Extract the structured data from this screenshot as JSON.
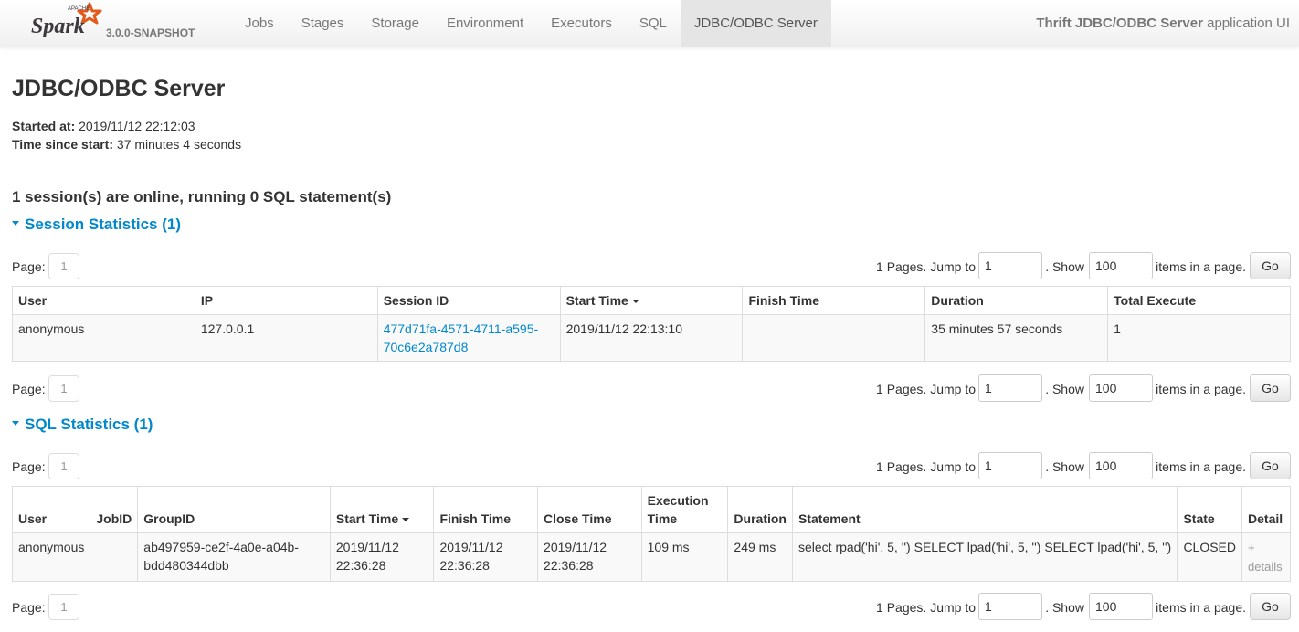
{
  "navbar": {
    "brand_super": "APACHE",
    "brand_name": "Spark",
    "version": "3.0.0-SNAPSHOT",
    "tabs": [
      {
        "label": "Jobs"
      },
      {
        "label": "Stages"
      },
      {
        "label": "Storage"
      },
      {
        "label": "Environment"
      },
      {
        "label": "Executors"
      },
      {
        "label": "SQL"
      },
      {
        "label": "JDBC/ODBC Server",
        "active": true
      }
    ],
    "app_title_bold": "Thrift JDBC/ODBC Server",
    "app_title_rest": " application UI"
  },
  "page": {
    "title": "JDBC/ODBC Server",
    "started_label": "Started at:",
    "started_value": " 2019/11/12 22:12:03",
    "since_label": "Time since start:",
    "since_value": " 37 minutes 4 seconds",
    "summary": "1 session(s) are online, running 0 SQL statement(s)"
  },
  "pager": {
    "page_label": "Page:",
    "page_number": "1",
    "pages_text": "1 Pages. Jump to",
    "jump_value": "1",
    "show_text": ". Show",
    "show_value": "100",
    "items_text": "items in a page.",
    "go_label": "Go"
  },
  "session_stats": {
    "heading": "Session Statistics (1)",
    "columns": [
      "User",
      "IP",
      "Session ID",
      "Start Time",
      "Finish Time",
      "Duration",
      "Total Execute"
    ],
    "rows": [
      {
        "user": "anonymous",
        "ip": "127.0.0.1",
        "session_id": "477d71fa-4571-4711-a595-70c6e2a787d8",
        "start_time": "2019/11/12 22:13:10",
        "finish_time": "",
        "duration": "35 minutes 57 seconds",
        "total_execute": "1"
      }
    ]
  },
  "sql_stats": {
    "heading": "SQL Statistics (1)",
    "columns": [
      "User",
      "JobID",
      "GroupID",
      "Start Time",
      "Finish Time",
      "Close Time",
      "Execution Time",
      "Duration",
      "Statement",
      "State",
      "Detail"
    ],
    "rows": [
      {
        "user": "anonymous",
        "job_id": "",
        "group_id": "ab497959-ce2f-4a0e-a04b-bdd480344dbb",
        "start_time": "2019/11/12 22:36:28",
        "finish_time": "2019/11/12 22:36:28",
        "close_time": "2019/11/12 22:36:28",
        "execution_time": "109 ms",
        "duration": "249 ms",
        "statement": "select rpad('hi', 5, '') SELECT lpad('hi', 5, '') SELECT lpad('hi', 5, '')",
        "state": "CLOSED",
        "detail": "+ details"
      }
    ]
  },
  "colors": {
    "link": "#0088cc",
    "logo_orange": "#e25a1c",
    "logo_text": "#3c3a3e"
  }
}
